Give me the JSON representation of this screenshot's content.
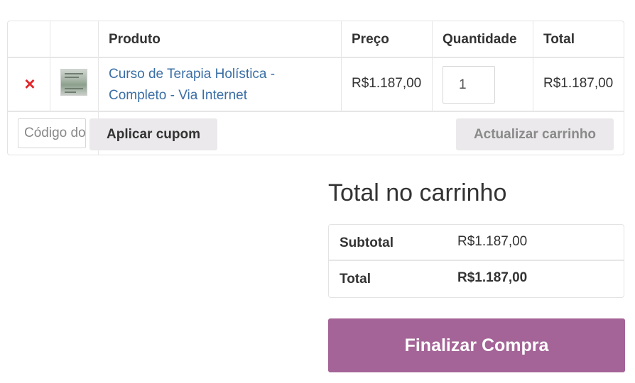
{
  "cart": {
    "headers": {
      "product": "Produto",
      "price": "Preço",
      "quantity": "Quantidade",
      "total": "Total"
    },
    "item": {
      "remove_icon": "×",
      "thumbnail_icon": "product-thumbnail",
      "name_line1": "Curso de Terapia Holística -",
      "name_line2": "Completo - Via Internet",
      "price": "R$1.187,00",
      "quantity": "1",
      "total": "R$1.187,00"
    },
    "coupon_placeholder": "Código do cupom",
    "apply_coupon_label": "Aplicar cupom",
    "update_cart_label": "Actualizar carrinho"
  },
  "totals": {
    "title": "Total no carrinho",
    "subtotal_label": "Subtotal",
    "subtotal_value": "R$1.187,00",
    "total_label": "Total",
    "total_value": "R$1.187,00"
  },
  "checkout": {
    "label": "Finalizar Compra"
  },
  "colors": {
    "accent": "#a46497",
    "link": "#3a6ea5",
    "remove": "#e2272d"
  }
}
